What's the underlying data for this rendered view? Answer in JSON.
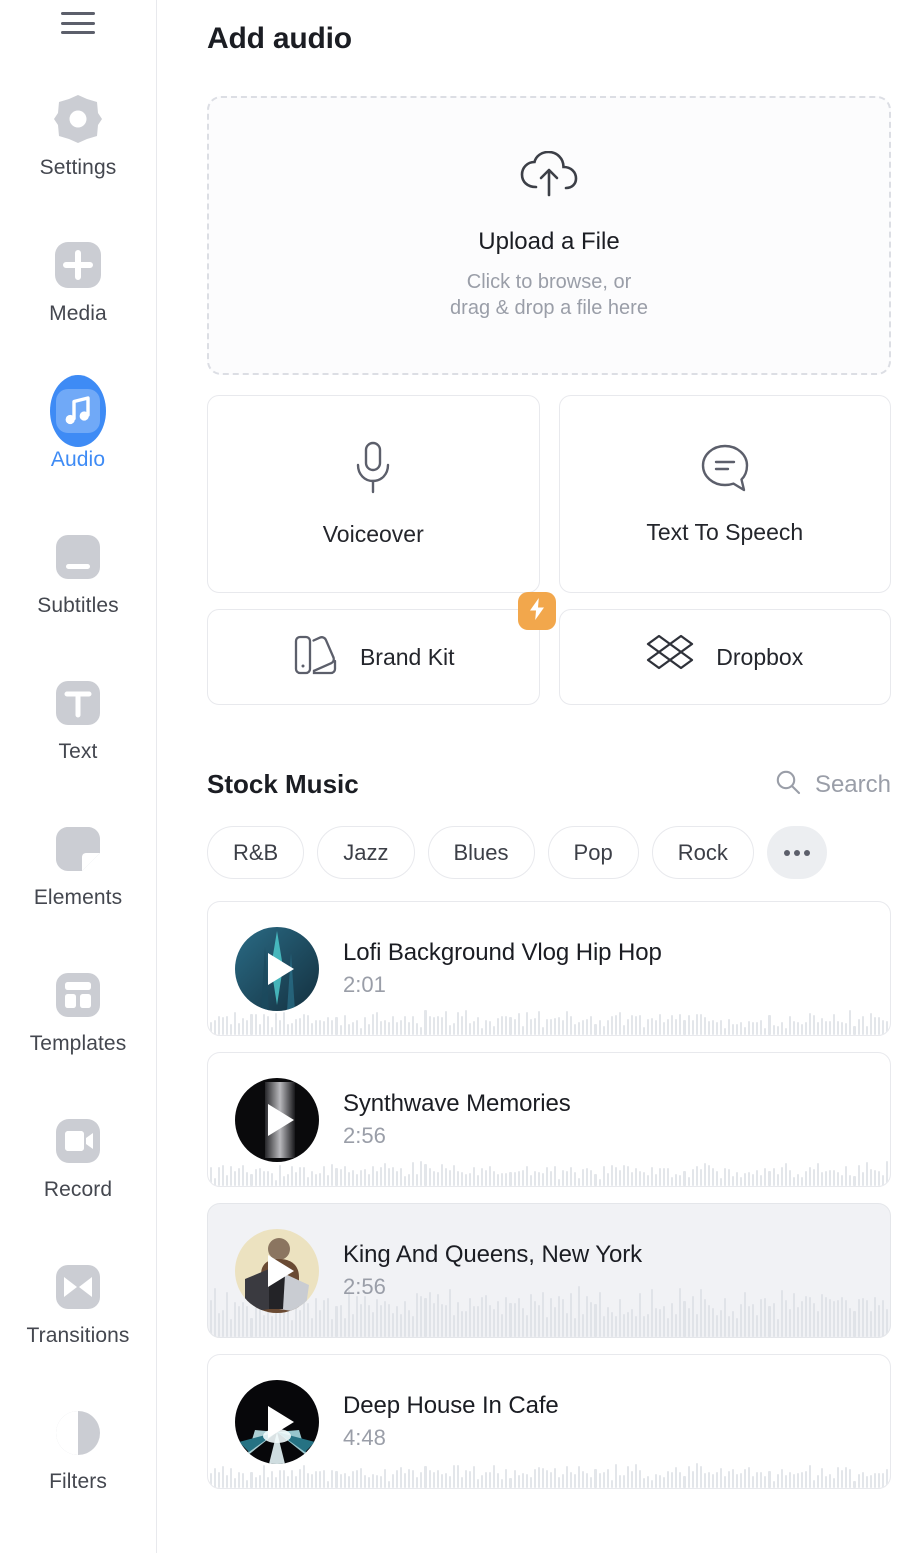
{
  "sidebar": {
    "menu_icon": "hamburger-menu-icon",
    "items": [
      {
        "label": "Settings",
        "icon": "gear-icon",
        "active": false
      },
      {
        "label": "Media",
        "icon": "plus-square-icon",
        "active": false
      },
      {
        "label": "Audio",
        "icon": "music-note-icon",
        "active": true
      },
      {
        "label": "Subtitles",
        "icon": "subtitles-icon",
        "active": false
      },
      {
        "label": "Text",
        "icon": "text-t-icon",
        "active": false
      },
      {
        "label": "Elements",
        "icon": "elements-icon",
        "active": false
      },
      {
        "label": "Templates",
        "icon": "templates-icon",
        "active": false
      },
      {
        "label": "Record",
        "icon": "video-camera-icon",
        "active": false
      },
      {
        "label": "Transitions",
        "icon": "transitions-icon",
        "active": false
      },
      {
        "label": "Filters",
        "icon": "contrast-icon",
        "active": false
      }
    ]
  },
  "main": {
    "title": "Add audio",
    "upload": {
      "icon": "cloud-upload-icon",
      "title": "Upload a File",
      "subtitle_line1": "Click to browse, or",
      "subtitle_line2": "drag & drop a file here"
    },
    "actions": [
      {
        "label": "Voiceover",
        "icon": "microphone-icon"
      },
      {
        "label": "Text To Speech",
        "icon": "speech-bubble-icon"
      }
    ],
    "actions_small": [
      {
        "label": "Brand Kit",
        "icon": "brand-kit-icon",
        "badge": "lightning-bolt-icon",
        "badge_color": "#f2a74c"
      },
      {
        "label": "Dropbox",
        "icon": "dropbox-icon",
        "badge": null,
        "badge_color": null
      }
    ],
    "stock": {
      "title": "Stock Music",
      "search_label": "Search",
      "search_icon": "search-icon",
      "genres": [
        "R&B",
        "Jazz",
        "Blues",
        "Pop",
        "Rock"
      ],
      "more_label": "more-genres-icon",
      "tracks": [
        {
          "title": "Lofi Background Vlog Hip Hop",
          "duration": "2:01",
          "art": "teal-gradient",
          "hover": false
        },
        {
          "title": "Synthwave Memories",
          "duration": "2:56",
          "art": "black-gradient",
          "hover": false
        },
        {
          "title": "King And Queens, New York",
          "duration": "2:56",
          "art": "cream-accordion",
          "hover": true
        },
        {
          "title": "Deep House In Cafe",
          "duration": "4:48",
          "art": "dark-burst",
          "hover": false
        }
      ]
    }
  },
  "colors": {
    "accent_blue": "#3e8bf5",
    "badge_orange": "#f2a74c",
    "text_dark": "#1b1d23",
    "text_muted": "#9a9ea8",
    "border": "#e8e9ed"
  }
}
